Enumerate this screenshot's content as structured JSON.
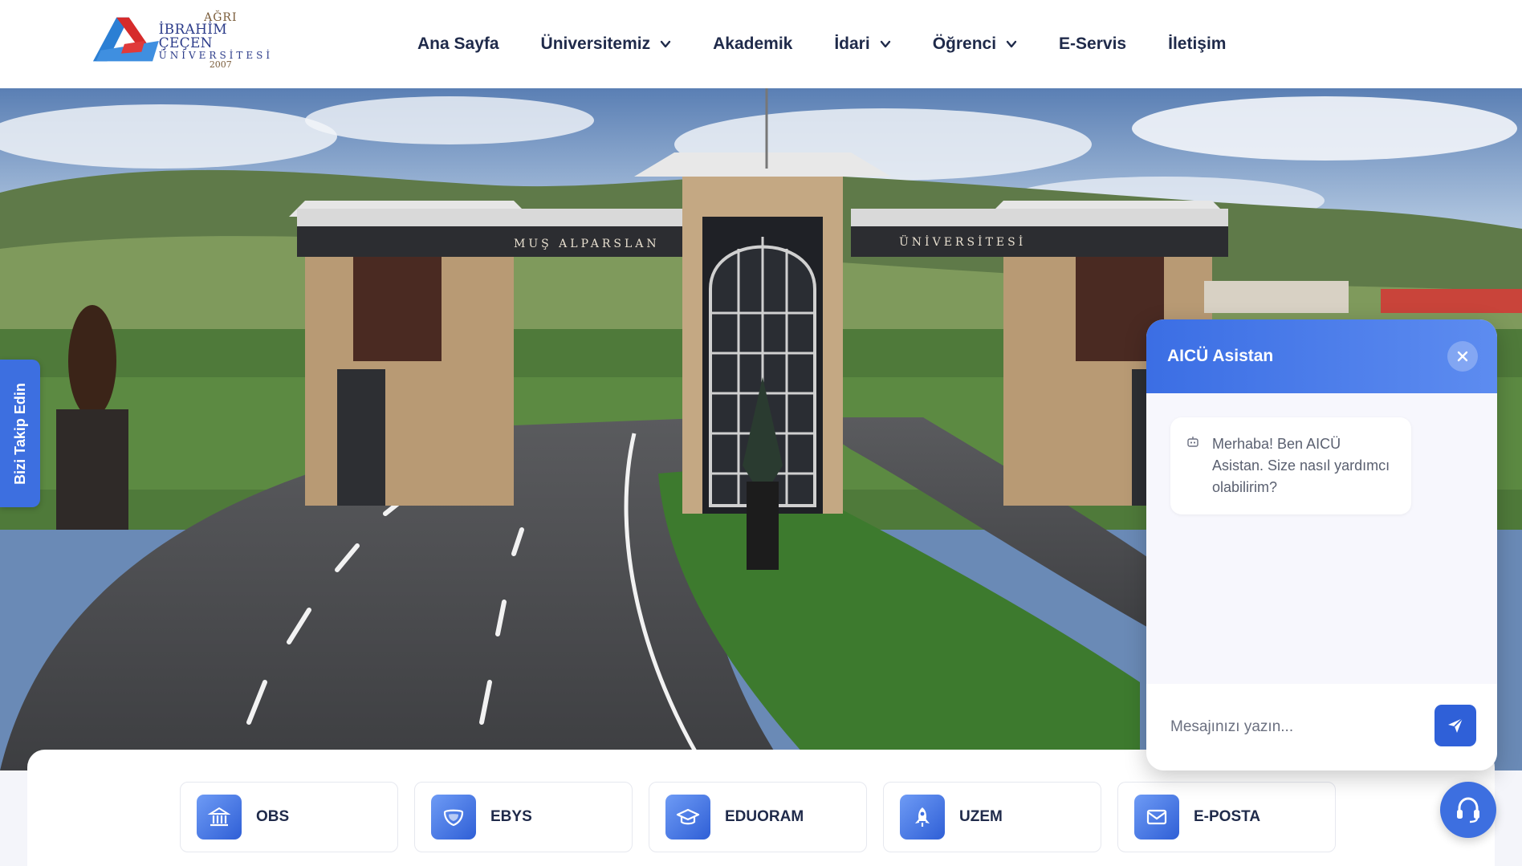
{
  "header": {
    "logo": {
      "line1": "AĞRI",
      "line2": "İBRAHİM ÇEÇEN",
      "line3": "ÜNİVERSİTESİ",
      "line4": "2007"
    },
    "nav": [
      {
        "label": "Ana Sayfa",
        "dropdown": false
      },
      {
        "label": "Üniversitemiz",
        "dropdown": true
      },
      {
        "label": "Akademik",
        "dropdown": false
      },
      {
        "label": "İdari",
        "dropdown": true
      },
      {
        "label": "Öğrenci",
        "dropdown": true
      },
      {
        "label": "E-Servis",
        "dropdown": false
      },
      {
        "label": "İletişim",
        "dropdown": false
      }
    ]
  },
  "hero": {
    "gate_text_left": "MUŞ ALPARSLAN",
    "gate_text_right": "ÜNİVERSİTESİ"
  },
  "follow_tab": {
    "label": "Bizi Takip Edin"
  },
  "quick_links": [
    {
      "label": "OBS",
      "icon": "bank-icon"
    },
    {
      "label": "EBYS",
      "icon": "shield-icon"
    },
    {
      "label": "EDUORAM",
      "icon": "graduation-cap-icon"
    },
    {
      "label": "UZEM",
      "icon": "rocket-icon"
    },
    {
      "label": "E-POSTA",
      "icon": "mail-icon"
    }
  ],
  "chat": {
    "title": "AICÜ Asistan",
    "messages": [
      {
        "from": "bot",
        "text": "Merhaba! Ben AICÜ Asistan. Size nasıl yardımcı olabilirim?"
      }
    ],
    "input_placeholder": "Mesajınızı yazın...",
    "input_value": ""
  },
  "colors": {
    "accent": "#3d6fe0",
    "nav_text": "#1f2a4a",
    "header_bg": "#ffffff"
  }
}
